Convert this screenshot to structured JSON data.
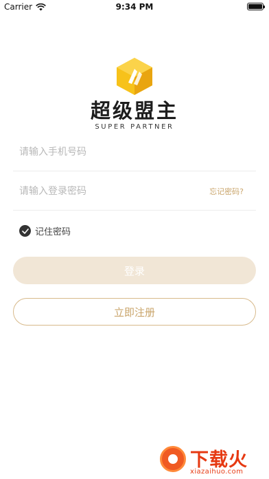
{
  "status_bar": {
    "carrier": "Carrier",
    "time": "9:34 PM",
    "wifi_icon": "wifi-icon",
    "battery_icon": "battery-icon"
  },
  "logo": {
    "icon": "hexagon-logo-icon",
    "title": "超级盟主",
    "subtitle": "SUPER PARTNER",
    "colors": {
      "primary": "#f7c21a",
      "secondary": "#e9a510"
    }
  },
  "form": {
    "phone": {
      "value": "",
      "placeholder": "请输入手机号码"
    },
    "password": {
      "value": "",
      "placeholder": "请输入登录密码"
    },
    "forgot_password": "忘记密码?",
    "remember_label": "记住密码",
    "remember_checked": true,
    "login_label": "登录",
    "register_label": "立即注册"
  },
  "watermark": {
    "title": "下载火",
    "url": "xiazaihuo.com"
  },
  "colors": {
    "accent": "#c9a46a",
    "login_button_bg": "#f1e6d6",
    "register_border": "#d7b98a"
  }
}
